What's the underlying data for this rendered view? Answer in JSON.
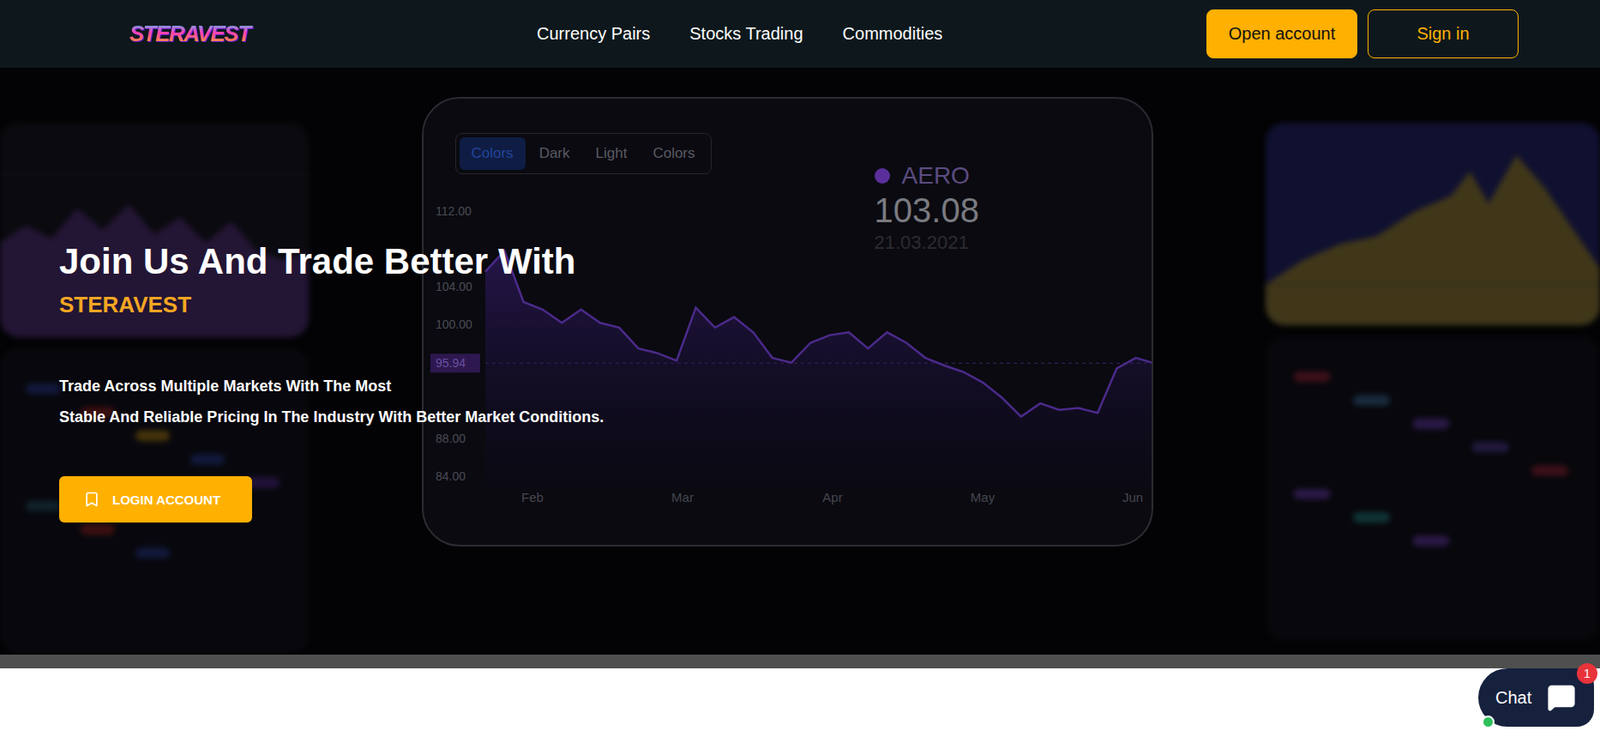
{
  "nav": {
    "logo": "STERAVEST",
    "links": [
      "Currency Pairs",
      "Stocks Trading",
      "Commodities"
    ],
    "buttons": [
      {
        "label": "Open account",
        "kind": "primary"
      },
      {
        "label": "Sign in",
        "kind": "outline"
      }
    ]
  },
  "hero": {
    "heading": "Join Us And Trade Better With",
    "brand": "STERAVEST",
    "lines": [
      "Trade Across Multiple Markets With The Most",
      "Stable And Reliable Pricing In The Industry With Better Market Conditions."
    ],
    "button": "LOGIN ACCOUNT"
  },
  "chart": {
    "tabs": [
      {
        "label": "Colors",
        "selected": true
      },
      {
        "label": "Dark",
        "selected": false
      },
      {
        "label": "Light",
        "selected": false
      },
      {
        "label": "Colors",
        "selected": false
      }
    ],
    "ticker": {
      "symbol": "AERO",
      "price": "103.08",
      "date": "21.03.2021"
    },
    "y_ticks": [
      "112.00",
      "104.00",
      "100.00",
      "88.00",
      "84.00"
    ],
    "highlight": "95.94",
    "x_ticks": [
      "Feb",
      "Mar",
      "Apr",
      "May",
      "Jun"
    ],
    "series": [
      {
        "name": "AERO",
        "values": [
          105.6,
          107.8,
          102.4,
          101.6,
          100.2,
          101.6,
          100.2,
          99.7,
          97.5,
          97,
          96.2,
          101.8,
          99.7,
          100.8,
          99.2,
          96.5,
          96,
          98.1,
          98.9,
          99.2,
          97.5,
          99.2,
          98.1,
          96.5,
          95.7,
          95,
          93.9,
          92.3,
          90.3,
          91.7,
          91,
          91.2,
          90.7,
          95.4,
          96.5,
          95.9
        ],
        "color": "#4b2a8a"
      }
    ]
  },
  "chat": {
    "label": "Chat",
    "badge": "1",
    "online": true
  }
}
